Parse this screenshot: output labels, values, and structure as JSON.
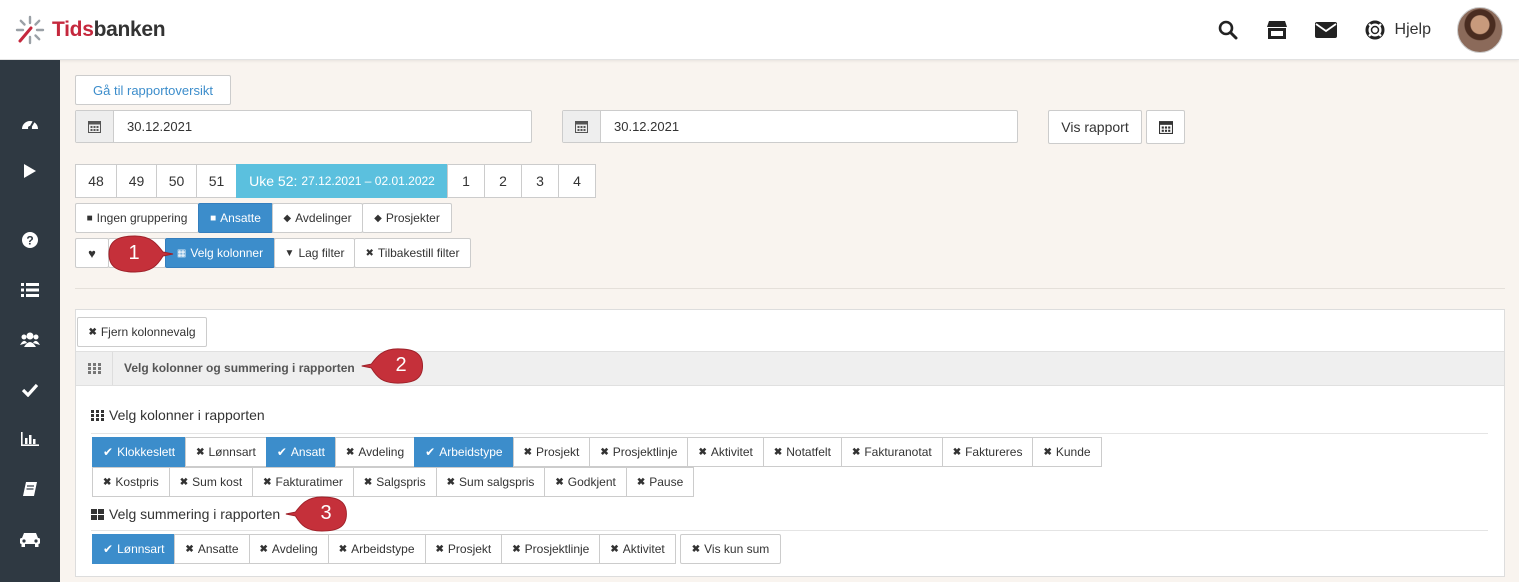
{
  "brand": {
    "name_red": "Tids",
    "name_rest": "banken",
    "accent": "#c5283d"
  },
  "header": {
    "help_label": "Hjelp",
    "icons": [
      "search-icon",
      "store-icon",
      "mail-icon",
      "lifebuoy-icon"
    ]
  },
  "sidebar": {
    "icons": [
      "dashboard-icon",
      "play-icon",
      "question-icon",
      "list-icon",
      "users-icon",
      "check-icon",
      "bar-chart-icon",
      "book-icon",
      "car-icon"
    ]
  },
  "toolbar": {
    "report_overview": "Gå til rapportoversikt",
    "date_from": "30.12.2021",
    "date_to": "30.12.2021",
    "show_report": "Vis rapport"
  },
  "weeks": {
    "before": [
      "48",
      "49",
      "50",
      "51"
    ],
    "active_label": "Uke 52:",
    "active_range": "27.12.2021 – 02.01.2022",
    "after": [
      "1",
      "2",
      "3",
      "4"
    ]
  },
  "grouping": [
    "Ingen gruppering",
    "Ansatte",
    "Avdelinger",
    "Prosjekter"
  ],
  "actions": {
    "choose_columns": "Velg kolonner",
    "make_filter": "Lag filter",
    "reset_filter": "Tilbakestill filter"
  },
  "panel": {
    "remove_columns": "Fjern kolonnevalg",
    "title": "Velg kolonner og summering i rapporten",
    "columns_title": "Velg kolonner i rapporten",
    "columns_row1": [
      {
        "label": "Klokkeslett",
        "on": true
      },
      {
        "label": "Lønnsart",
        "on": false
      },
      {
        "label": "Ansatt",
        "on": true
      },
      {
        "label": "Avdeling",
        "on": false
      },
      {
        "label": "Arbeidstype",
        "on": true
      },
      {
        "label": "Prosjekt",
        "on": false
      },
      {
        "label": "Prosjektlinje",
        "on": false
      },
      {
        "label": "Aktivitet",
        "on": false
      },
      {
        "label": "Notatfelt",
        "on": false
      },
      {
        "label": "Fakturanotat",
        "on": false
      },
      {
        "label": "Faktureres",
        "on": false
      },
      {
        "label": "Kunde",
        "on": false
      }
    ],
    "columns_row2": [
      {
        "label": "Kostpris",
        "on": false
      },
      {
        "label": "Sum kost",
        "on": false
      },
      {
        "label": "Fakturatimer",
        "on": false
      },
      {
        "label": "Salgspris",
        "on": false
      },
      {
        "label": "Sum salgspris",
        "on": false
      },
      {
        "label": "Godkjent",
        "on": false
      },
      {
        "label": "Pause",
        "on": false
      }
    ],
    "summary_title": "Velg summering i rapporten",
    "summary": [
      {
        "label": "Lønnsart",
        "on": true
      },
      {
        "label": "Ansatte",
        "on": false
      },
      {
        "label": "Avdeling",
        "on": false
      },
      {
        "label": "Arbeidstype",
        "on": false
      },
      {
        "label": "Prosjekt",
        "on": false
      },
      {
        "label": "Prosjektlinje",
        "on": false
      },
      {
        "label": "Aktivitet",
        "on": false
      }
    ],
    "sum_only": "Vis kun sum"
  },
  "callouts": [
    "1",
    "2",
    "3"
  ]
}
